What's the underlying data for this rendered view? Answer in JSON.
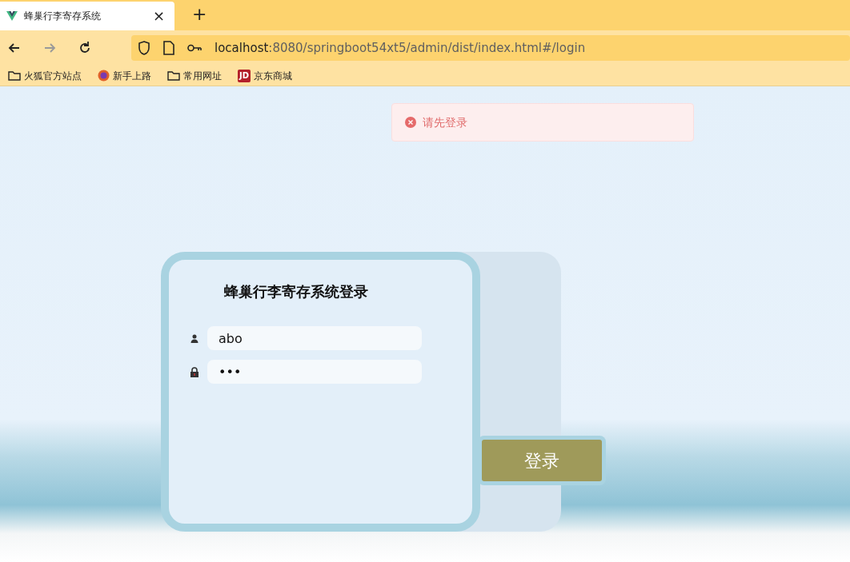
{
  "browser": {
    "tab": {
      "title": "蜂巢行李寄存系统",
      "close": "×",
      "selected": true
    },
    "new_tab": "+",
    "url": {
      "host": "localhost",
      "path": ":8080/springboot54xt5/admin/dist/index.html#/login"
    },
    "bookmarks": [
      {
        "kind": "folder",
        "label": "火狐官方站点"
      },
      {
        "kind": "globe",
        "label": "新手上路"
      },
      {
        "kind": "folder",
        "label": "常用网址"
      },
      {
        "kind": "logo",
        "icon_text": "JD",
        "label": "京东商城"
      }
    ]
  },
  "toast": {
    "kind": "error",
    "message": "请先登录"
  },
  "login": {
    "title": "蜂巢行李寄存系统登录",
    "username": {
      "value": "abo"
    },
    "password": {
      "value": "•••"
    },
    "submit": "登录"
  }
}
